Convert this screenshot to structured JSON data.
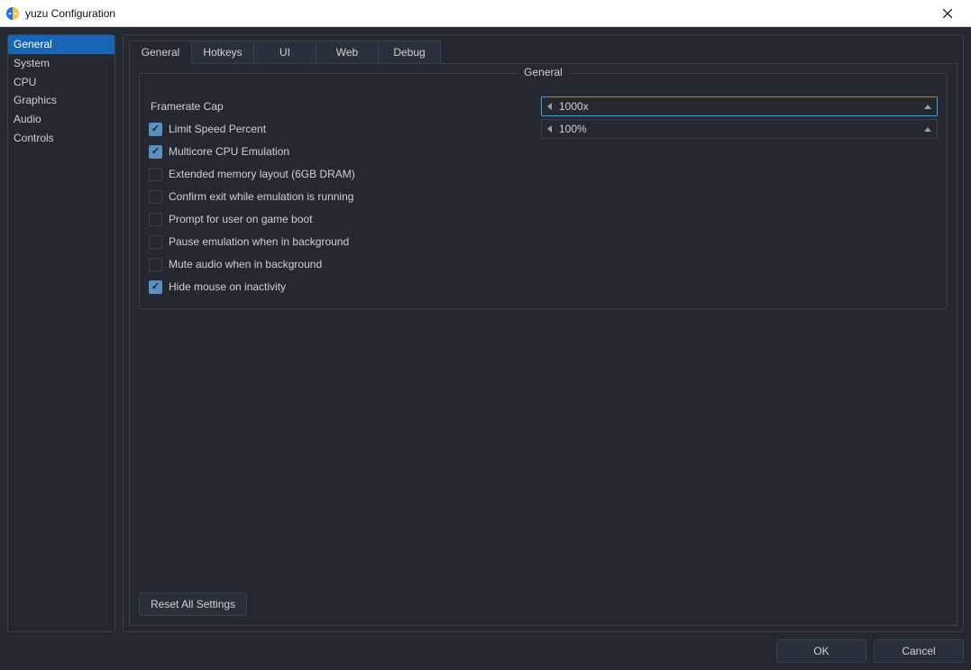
{
  "window": {
    "title": "yuzu Configuration"
  },
  "sidebar": {
    "items": [
      {
        "id": "general",
        "label": "General"
      },
      {
        "id": "system",
        "label": "System"
      },
      {
        "id": "cpu",
        "label": "CPU"
      },
      {
        "id": "graphics",
        "label": "Graphics"
      },
      {
        "id": "audio",
        "label": "Audio"
      },
      {
        "id": "controls",
        "label": "Controls"
      }
    ],
    "selected": "general"
  },
  "tabs": {
    "items": [
      {
        "id": "general",
        "label": "General"
      },
      {
        "id": "hotkeys",
        "label": "Hotkeys"
      },
      {
        "id": "ui",
        "label": "UI"
      },
      {
        "id": "web",
        "label": "Web"
      },
      {
        "id": "debug",
        "label": "Debug"
      }
    ],
    "active": "general"
  },
  "group": {
    "title": "General",
    "framerate_cap": {
      "label": "Framerate Cap",
      "value": "1000x"
    },
    "limit_speed": {
      "label": "Limit Speed Percent",
      "checked": true,
      "value": "100%"
    },
    "checks": [
      {
        "id": "multicore",
        "label": "Multicore CPU Emulation",
        "checked": true
      },
      {
        "id": "extmem",
        "label": "Extended memory layout (6GB DRAM)",
        "checked": false
      },
      {
        "id": "confirmexit",
        "label": "Confirm exit while emulation is running",
        "checked": false
      },
      {
        "id": "promptuser",
        "label": "Prompt for user on game boot",
        "checked": false
      },
      {
        "id": "pausebg",
        "label": "Pause emulation when in background",
        "checked": false
      },
      {
        "id": "mutebg",
        "label": "Mute audio when in background",
        "checked": false
      },
      {
        "id": "hidemouse",
        "label": "Hide mouse on inactivity",
        "checked": true
      }
    ]
  },
  "buttons": {
    "reset": "Reset All Settings",
    "ok": "OK",
    "cancel": "Cancel"
  }
}
